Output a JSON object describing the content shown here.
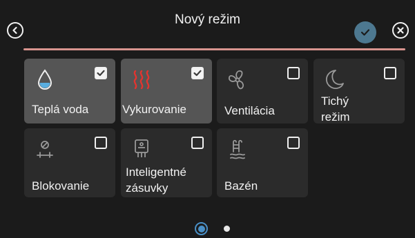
{
  "header": {
    "title": "Nový režim",
    "back_icon": "chevron-left-circle-icon",
    "confirm_icon": "check-circle-icon",
    "close_icon": "close-circle-icon",
    "confirm_color": "#4d7890",
    "divider_color": "#d9958f"
  },
  "tiles": [
    {
      "label": "Teplá voda",
      "icon": "water-drop-icon",
      "checked": true,
      "selected": true
    },
    {
      "label": "Vykurovanie",
      "icon": "heating-waves-icon",
      "checked": true,
      "selected": true
    },
    {
      "label": "Ventilácia",
      "icon": "fan-icon",
      "checked": false,
      "selected": false
    },
    {
      "label": "Tichý režim",
      "icon": "moon-icon",
      "checked": false,
      "selected": false
    },
    {
      "label": "Blokovanie",
      "icon": "blocking-icon",
      "checked": false,
      "selected": false
    },
    {
      "label": "Inteligentné zásuvky",
      "icon": "smart-plug-icon",
      "checked": false,
      "selected": false
    },
    {
      "label": "Bazén",
      "icon": "pool-icon",
      "checked": false,
      "selected": false
    }
  ],
  "pager": {
    "pages": 2,
    "current": 1,
    "active_color": "#4a90c7"
  }
}
